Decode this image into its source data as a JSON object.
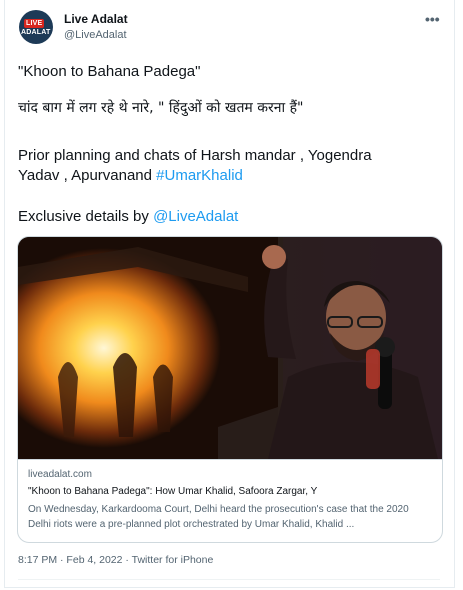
{
  "tweet": {
    "author": {
      "name": "Live Adalat",
      "handle": "@LiveAdalat",
      "avatar_logo_text": [
        "LIVE",
        "ADALAT"
      ]
    },
    "more_icon": "more-horizontal-icon",
    "lines": {
      "line1": "\"Khoon to Bahana Padega\"",
      "line2": "चांद बाग में लग रहे थे नारे, \" हिंदुओं को खतम करना हैं\"",
      "line3": "Prior planning and chats of Harsh mandar , Yogendra",
      "line4_text": "Yadav , Apurvanand ",
      "line4_hashtag": "#UmarKhalid",
      "line5_text": "Exclusive details by ",
      "line5_mention": "@LiveAdalat"
    },
    "link_card": {
      "domain": "liveadalat.com",
      "title": "\"Khoon to Bahana Padega\": How Umar Khalid, Safoora Zargar, Y",
      "description": "On Wednesday, Karkardooma Court, Delhi heard the prosecution's case that the 2020 Delhi riots were a pre-planned plot orchestrated by Umar Khalid, Khalid ..."
    },
    "timestamp": "8:17 PM · Feb 4, 2022 · Twitter for iPhone"
  },
  "colors": {
    "link": "#1d9bf0",
    "secondary_text": "#536471",
    "border": "#cfd9de",
    "avatar_bg": "#1d3a57",
    "avatar_badge": "#d7261e"
  }
}
